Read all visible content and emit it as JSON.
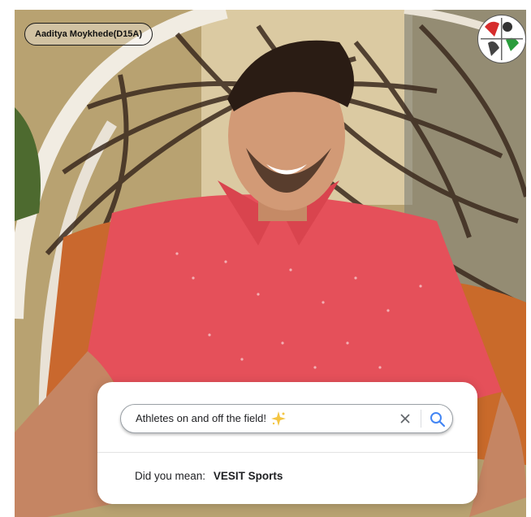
{
  "profile": {
    "name_chip": "Aaditya Moykhede(D15A)"
  },
  "search": {
    "query": "Athletes on and off the field!",
    "sparkle_icon": "sparkle-emoji-icon",
    "clear_icon": "close-icon",
    "search_icon": "magnifier-icon"
  },
  "suggestion": {
    "prefix": "Did you mean:",
    "term": "VESIT Sports"
  },
  "logo": {
    "icon": "vesit-sports-logo"
  },
  "colors": {
    "search_accent": "#4285f4",
    "shirt": "#e5505a",
    "card_bg": "#ffffff"
  }
}
